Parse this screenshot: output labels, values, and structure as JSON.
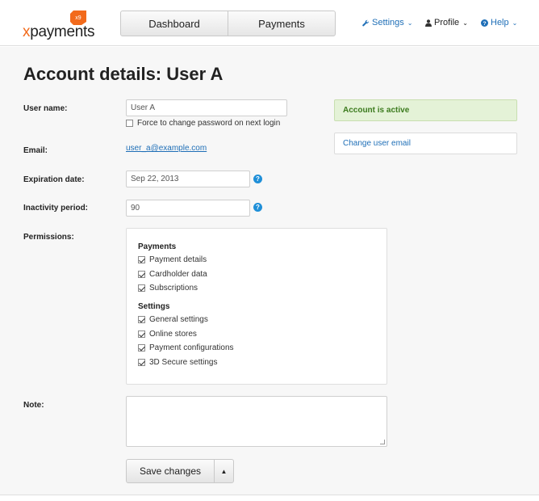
{
  "header": {
    "logo_text_x": "x",
    "logo_text_rest": "payments",
    "logo_badge": "x9",
    "nav": [
      {
        "label": "Dashboard"
      },
      {
        "label": "Payments"
      }
    ],
    "settings_label": "Settings",
    "profile_label": "Profile",
    "help_label": "Help"
  },
  "page": {
    "title": "Account details: User A"
  },
  "form": {
    "username_label": "User name:",
    "username_value": "User A",
    "force_password_label": "Force to change password on next login",
    "force_password_checked": false,
    "email_label": "Email:",
    "email_value": "user_a@example.com",
    "expiration_label": "Expiration date:",
    "expiration_value": "Sep 22, 2013",
    "inactivity_label": "Inactivity period:",
    "inactivity_value": "90",
    "permissions_label": "Permissions:",
    "note_label": "Note:"
  },
  "permissions": {
    "payments_title": "Payments",
    "payments": [
      {
        "label": "Payment details",
        "checked": true
      },
      {
        "label": "Cardholder data",
        "checked": true
      },
      {
        "label": "Subscriptions",
        "checked": true
      }
    ],
    "settings_title": "Settings",
    "settings": [
      {
        "label": "General settings",
        "checked": true
      },
      {
        "label": "Online stores",
        "checked": true
      },
      {
        "label": "Payment configurations",
        "checked": true
      },
      {
        "label": "3D Secure settings",
        "checked": true
      }
    ]
  },
  "side": {
    "status": "Account is active",
    "change_email": "Change user email"
  },
  "actions": {
    "save_label": "Save changes",
    "caret": "▲"
  },
  "icons": {
    "help_glyph": "?"
  },
  "colors": {
    "accent": "#1f6fb7",
    "brand_orange": "#f26a1b",
    "success_bg": "#e4f2d7",
    "success_text": "#3b7a1d"
  }
}
